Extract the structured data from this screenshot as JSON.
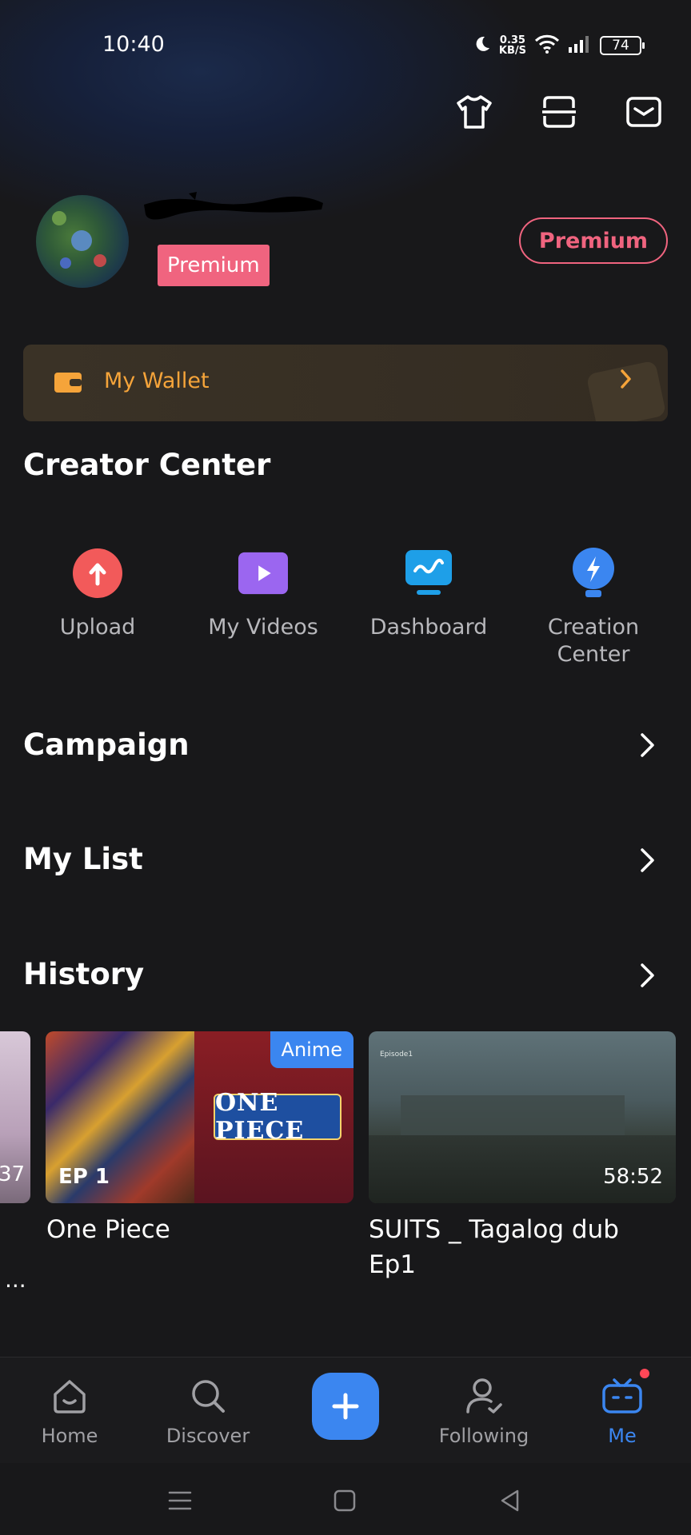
{
  "status_bar": {
    "time": "10:40",
    "net_speed_value": "0.35",
    "net_speed_unit": "KB/S",
    "battery": "74"
  },
  "profile": {
    "premium_tag": "Premium",
    "premium_button": "Premium"
  },
  "wallet": {
    "label": "My Wallet"
  },
  "creator_center": {
    "title": "Creator Center",
    "items": [
      {
        "label": "Upload"
      },
      {
        "label": "My Videos"
      },
      {
        "label": "Dashboard"
      },
      {
        "label": "Creation Center"
      }
    ]
  },
  "sections": {
    "campaign": "Campaign",
    "my_list": "My List",
    "history": "History"
  },
  "history": {
    "partial_card": {
      "duration_fragment": "37",
      "ellipsis": "..."
    },
    "cards": [
      {
        "title": "One Piece",
        "episode": "EP 1",
        "tag": "Anime",
        "logo_text": "ONE PIECE"
      },
      {
        "title": "SUITS _ Tagalog dub Ep1",
        "duration": "58:52",
        "overlay_text": "Episode1"
      }
    ]
  },
  "bottom_nav": {
    "home": "Home",
    "discover": "Discover",
    "following": "Following",
    "me": "Me"
  },
  "colors": {
    "accent_blue": "#3b86f0",
    "premium_pink": "#f0647f",
    "wallet_orange": "#f5a43a",
    "background": "#18181a"
  }
}
